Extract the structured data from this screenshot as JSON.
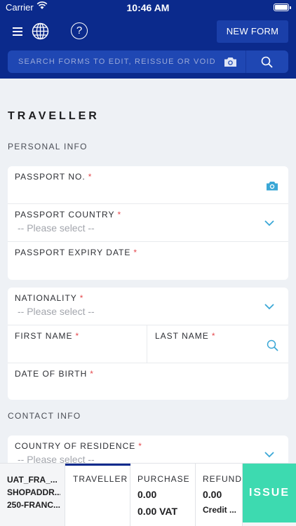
{
  "status_bar": {
    "carrier": "Carrier",
    "time": "10:46 AM"
  },
  "header": {
    "new_form_label": "NEW FORM",
    "search_placeholder": "SEARCH FORMS TO EDIT, REISSUE OR VOID",
    "icons": [
      "menu-icon",
      "globe-icon",
      "help-icon",
      "camera-icon",
      "search-icon"
    ],
    "help_glyph": "?"
  },
  "page": {
    "title": "TRAVELLER"
  },
  "personal_info": {
    "label": "PERSONAL INFO",
    "passport_no": {
      "label": "PASSPORT NO.",
      "required": "*"
    },
    "passport_country": {
      "label": "PASSPORT COUNTRY",
      "required": "*",
      "value": "-- Please select --"
    },
    "passport_expiry": {
      "label": "PASSPORT EXPIRY DATE",
      "required": "*"
    },
    "nationality": {
      "label": "NATIONALITY",
      "required": "*",
      "value": "-- Please select --"
    },
    "first_name": {
      "label": "FIRST NAME",
      "required": "*"
    },
    "last_name": {
      "label": "LAST NAME",
      "required": "*"
    },
    "date_of_birth": {
      "label": "DATE OF BIRTH",
      "required": "*"
    }
  },
  "contact_info": {
    "label": "CONTACT INFO",
    "country_of_residence": {
      "label": "COUNTRY OF RESIDENCE",
      "required": "*",
      "value": "-- Please select --"
    }
  },
  "bottom_bar": {
    "account": {
      "line1": "UAT_FRA_...",
      "line2": "SHOPADDR...",
      "line3": "250-FRANC..."
    },
    "traveller_tab": "TRAVELLER",
    "purchase": {
      "label": "PURCHASE",
      "amount": "0.00",
      "vat": "0.00 VAT"
    },
    "refund": {
      "label": "REFUND",
      "amount": "0.00",
      "method": "Credit ..."
    },
    "issue_label": "ISSUE"
  },
  "colors": {
    "header": "#0b2a8c",
    "search": "#1f47b3",
    "accent_icon": "#3aa7d6",
    "issue": "#3ddab0",
    "required": "#e5484d"
  }
}
